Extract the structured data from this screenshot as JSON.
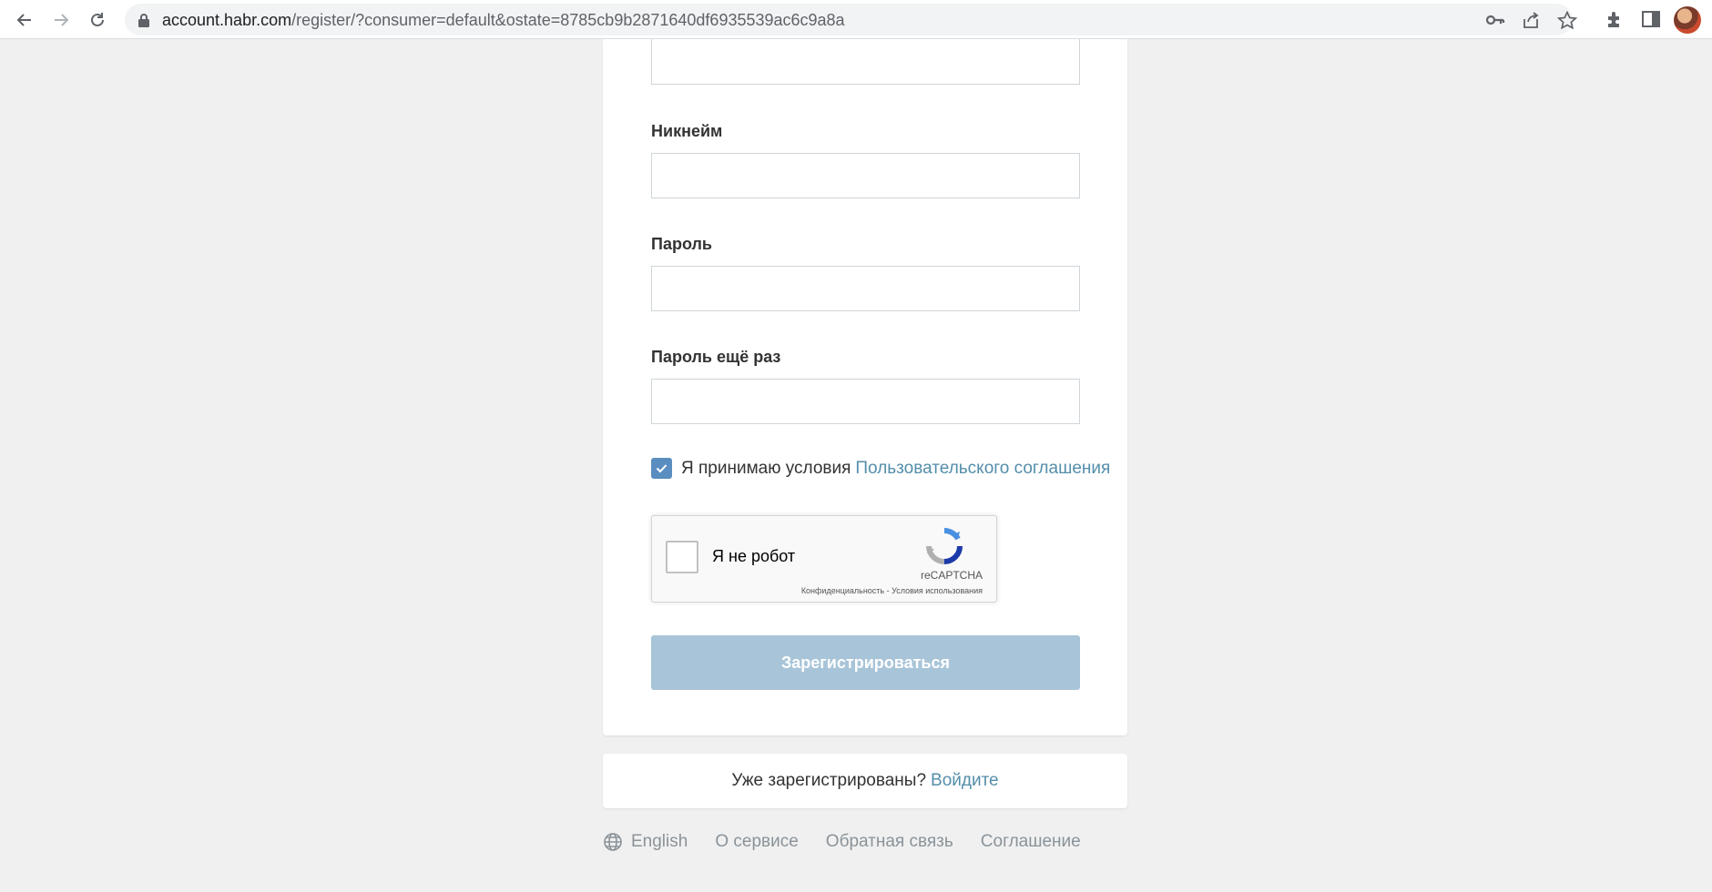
{
  "browser": {
    "url_host": "account.habr.com",
    "url_path": "/register/?consumer=default&ostate=8785cb9b2871640df6935539ac6c9a8a"
  },
  "form": {
    "nickname_label": "Никнейм",
    "password_label": "Пароль",
    "password_repeat_label": "Пароль ещё раз",
    "agree_text": "Я принимаю условия",
    "agree_link": "Пользовательского соглашения",
    "agree_checked": true,
    "submit_label": "Зарегистрироваться"
  },
  "recaptcha": {
    "label": "Я не робот",
    "brand": "reCAPTCHA",
    "links": "Конфиденциальность - Условия использования"
  },
  "login": {
    "text": "Уже зарегистрированы?",
    "link": "Войдите"
  },
  "footer": {
    "language": "English",
    "about": "О сервисе",
    "feedback": "Обратная связь",
    "agreement": "Соглашение"
  },
  "colors": {
    "link": "#548eaa",
    "submit_disabled": "#a8c4d8",
    "checkbox": "#5a8ec0",
    "page_bg": "#f0f0f0"
  },
  "icons": [
    "back-icon",
    "forward-icon",
    "reload-icon",
    "lock-icon",
    "key-icon",
    "share-icon",
    "star-icon",
    "extensions-icon",
    "sidebar-icon",
    "globe-icon",
    "recaptcha-logo-icon"
  ]
}
